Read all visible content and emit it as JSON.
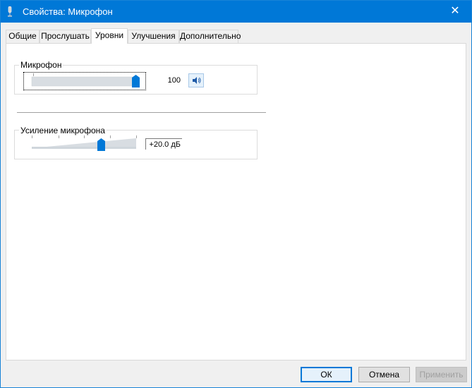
{
  "window": {
    "title": "Свойства: Микрофон",
    "close_glyph": "✕",
    "accent": "#0078d7"
  },
  "tabs": [
    {
      "label": "Общие",
      "active": false
    },
    {
      "label": "Прослушать",
      "active": false
    },
    {
      "label": "Уровни",
      "active": true
    },
    {
      "label": "Улучшения",
      "active": false
    },
    {
      "label": "Дополнительно",
      "active": false
    }
  ],
  "microphone": {
    "label": "Микрофон",
    "value": "100",
    "level_fraction": 1.0,
    "mute_icon": "speaker-icon"
  },
  "boost": {
    "label": "Усиление микрофона",
    "value": "+20.0 дБ",
    "level_fraction": 0.667
  },
  "buttons": {
    "ok": "ОК",
    "cancel": "Отмена",
    "apply": "Применить"
  }
}
